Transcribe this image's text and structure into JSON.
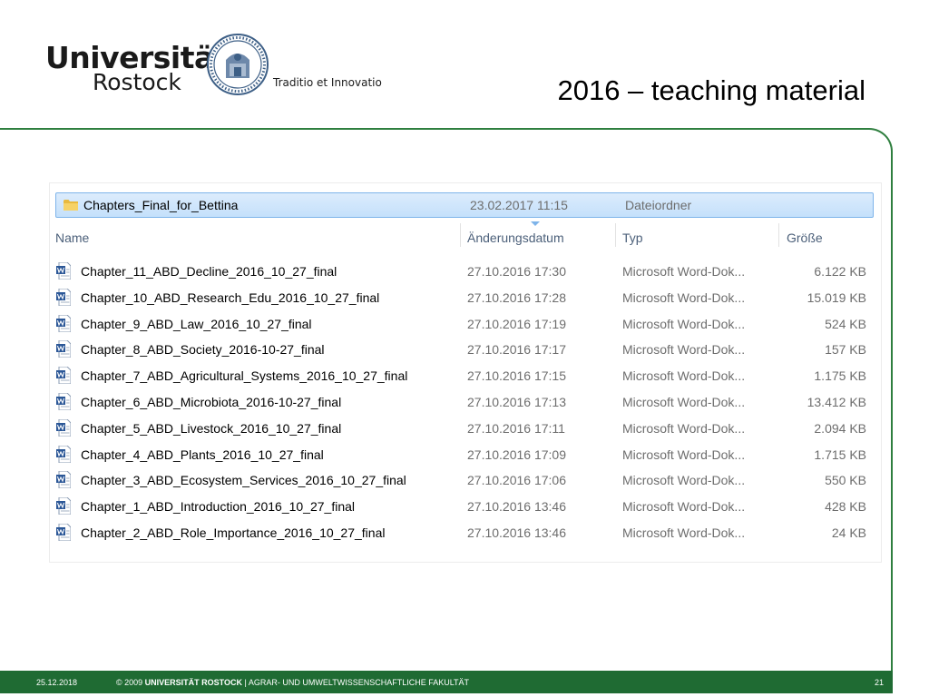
{
  "logo": {
    "word1": "Universität",
    "word2": "Rostock",
    "motto": "Traditio et Innovatio"
  },
  "title": "2016 – teaching material",
  "folder": {
    "name": "Chapters_Final_for_Bettina",
    "date": "23.02.2017 11:15",
    "type": "Dateiordner"
  },
  "columns": {
    "name": "Name",
    "date": "Änderungsdatum",
    "type": "Typ",
    "size": "Größe"
  },
  "files": [
    {
      "name": "Chapter_11_ABD_Decline_2016_10_27_final",
      "date": "27.10.2016 17:30",
      "type": "Microsoft Word-Dok...",
      "size": "6.122 KB"
    },
    {
      "name": "Chapter_10_ABD_Research_Edu_2016_10_27_final",
      "date": "27.10.2016 17:28",
      "type": "Microsoft Word-Dok...",
      "size": "15.019 KB"
    },
    {
      "name": "Chapter_9_ABD_Law_2016_10_27_final",
      "date": "27.10.2016 17:19",
      "type": "Microsoft Word-Dok...",
      "size": "524 KB"
    },
    {
      "name": "Chapter_8_ABD_Society_2016-10-27_final",
      "date": "27.10.2016 17:17",
      "type": "Microsoft Word-Dok...",
      "size": "157 KB"
    },
    {
      "name": "Chapter_7_ABD_Agricultural_Systems_2016_10_27_final",
      "date": "27.10.2016 17:15",
      "type": "Microsoft Word-Dok...",
      "size": "1.175 KB"
    },
    {
      "name": "Chapter_6_ABD_Microbiota_2016-10-27_final",
      "date": "27.10.2016 17:13",
      "type": "Microsoft Word-Dok...",
      "size": "13.412 KB"
    },
    {
      "name": "Chapter_5_ABD_Livestock_2016_10_27_final",
      "date": "27.10.2016 17:11",
      "type": "Microsoft Word-Dok...",
      "size": "2.094 KB"
    },
    {
      "name": "Chapter_4_ABD_Plants_2016_10_27_final",
      "date": "27.10.2016 17:09",
      "type": "Microsoft Word-Dok...",
      "size": "1.715 KB"
    },
    {
      "name": "Chapter_3_ABD_Ecosystem_Services_2016_10_27_final",
      "date": "27.10.2016 17:06",
      "type": "Microsoft Word-Dok...",
      "size": "550 KB"
    },
    {
      "name": "Chapter_1_ABD_Introduction_2016_10_27_final",
      "date": "27.10.2016 13:46",
      "type": "Microsoft Word-Dok...",
      "size": "428 KB"
    },
    {
      "name": "Chapter_2_ABD_Role_Importance_2016_10_27_final",
      "date": "27.10.2016 13:46",
      "type": "Microsoft Word-Dok...",
      "size": "24 KB"
    }
  ],
  "footer": {
    "date": "25.12.2018",
    "copyright": "© 2009",
    "university": "UNIVERSITÄT ROSTOCK",
    "faculty": "| AGRAR- UND UMWELTWISSENSCHAFTLICHE FAKULTÄT",
    "page": "21"
  },
  "colors": {
    "brand_green": "#1f6b33",
    "frame_green": "#2f7f3f",
    "selection_blue": "#c4e0fb",
    "header_text": "#4c607a"
  },
  "icons": {
    "folder": "folder-icon",
    "document": "word-document-icon",
    "seal": "university-seal-icon"
  }
}
